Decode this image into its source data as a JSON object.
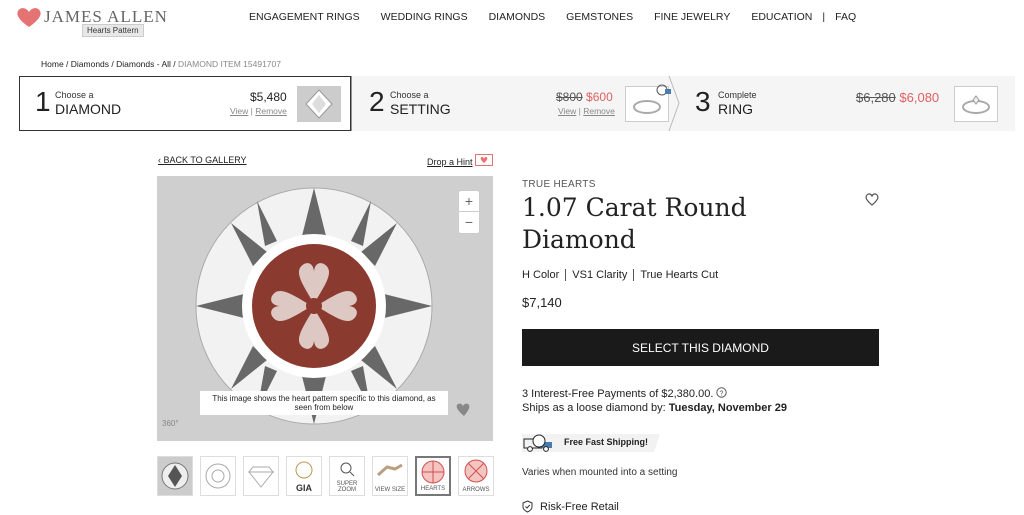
{
  "header": {
    "logo_text": "JAMES ALLEN",
    "tooltip": "Hearts Pattern",
    "nav": [
      "ENGAGEMENT RINGS",
      "WEDDING RINGS",
      "DIAMONDS",
      "GEMSTONES",
      "FINE JEWELRY",
      "EDUCATION",
      "|",
      "FAQ"
    ]
  },
  "breadcrumb": {
    "path": "Home / Diamonds / Diamonds - All / ",
    "current": "DIAMOND ITEM 15491707"
  },
  "steps": [
    {
      "num": "1",
      "small": "Choose a",
      "big": "DIAMOND",
      "price": "$5,480",
      "view": "View",
      "remove": "Remove"
    },
    {
      "num": "2",
      "small": "Choose a",
      "big": "SETTING",
      "old_price": "$800",
      "new_price": "$600",
      "view": "View",
      "remove": "Remove"
    },
    {
      "num": "3",
      "small": "Complete",
      "big": "RING",
      "old_price": "$6,280",
      "new_price": "$6,080"
    }
  ],
  "gallery": {
    "back": "BACK TO GALLERY",
    "hint": "Drop a Hint",
    "caption": "This image shows the heart pattern specific to this diamond, as seen from below",
    "label_360": "360°",
    "thumbs": [
      "",
      "",
      "",
      "GIA",
      "SUPER ZOOM",
      "VIEW SIZE",
      "HEARTS",
      "ARROWS"
    ]
  },
  "product": {
    "brand": "TRUE HEARTS",
    "title": "1.07 Carat Round Diamond",
    "specs": [
      "H Color",
      "VS1 Clarity",
      "True Hearts Cut"
    ],
    "price": "$7,140",
    "select_label": "SELECT THIS DIAMOND",
    "payments": "3 Interest-Free Payments of $2,380.00.",
    "ships_prefix": "Ships as a loose diamond by: ",
    "ships_date": "Tuesday, November 29",
    "free_shipping": "Free Fast Shipping!",
    "varies": "Varies when mounted into a setting",
    "risk_free": "Risk-Free Retail"
  },
  "colors": {
    "accent_red": "#e06060",
    "button_dark": "#1a1a1a"
  }
}
